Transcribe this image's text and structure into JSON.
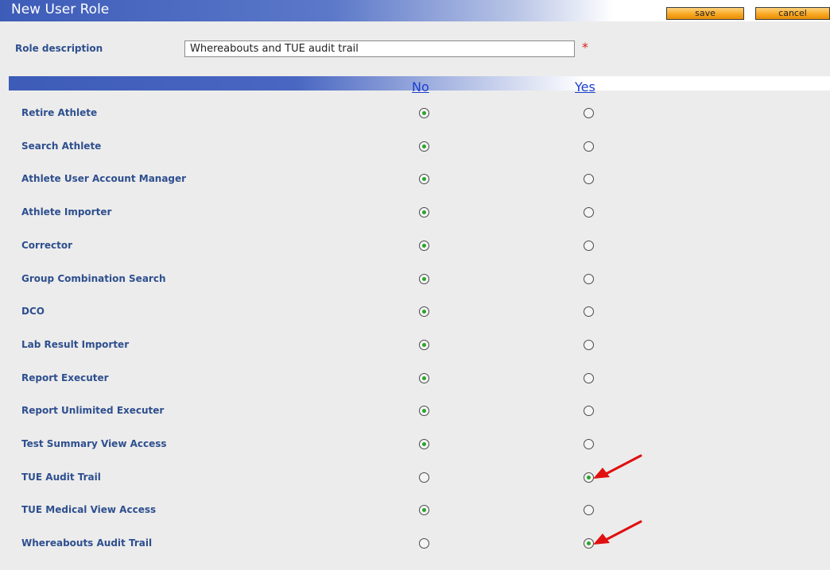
{
  "header": {
    "title": "New User Role",
    "save_label": "save",
    "cancel_label": "cancel"
  },
  "role_description": {
    "label": "Role description",
    "value": "Whereabouts and TUE audit trail",
    "required_mark": "*"
  },
  "columns": {
    "no": "No",
    "yes": "Yes"
  },
  "colors": {
    "title_bar": "#3d5cb8",
    "label_text": "#2e4f8e",
    "button_orange": "#f7a51e",
    "required": "#e02020",
    "arrow": "#e01010"
  },
  "permissions": [
    {
      "label": "Retire Athlete",
      "value": "No"
    },
    {
      "label": "Search Athlete",
      "value": "No"
    },
    {
      "label": "Athlete User Account Manager",
      "value": "No"
    },
    {
      "label": "Athlete Importer",
      "value": "No"
    },
    {
      "label": "Corrector",
      "value": "No"
    },
    {
      "label": "Group Combination Search",
      "value": "No"
    },
    {
      "label": "DCO",
      "value": "No"
    },
    {
      "label": "Lab Result Importer",
      "value": "No"
    },
    {
      "label": "Report Executer",
      "value": "No"
    },
    {
      "label": "Report Unlimited Executer",
      "value": "No"
    },
    {
      "label": "Test Summary View Access",
      "value": "No"
    },
    {
      "label": "TUE Audit Trail",
      "value": "Yes"
    },
    {
      "label": "TUE Medical View Access",
      "value": "No"
    },
    {
      "label": "Whereabouts Audit Trail",
      "value": "Yes"
    }
  ]
}
